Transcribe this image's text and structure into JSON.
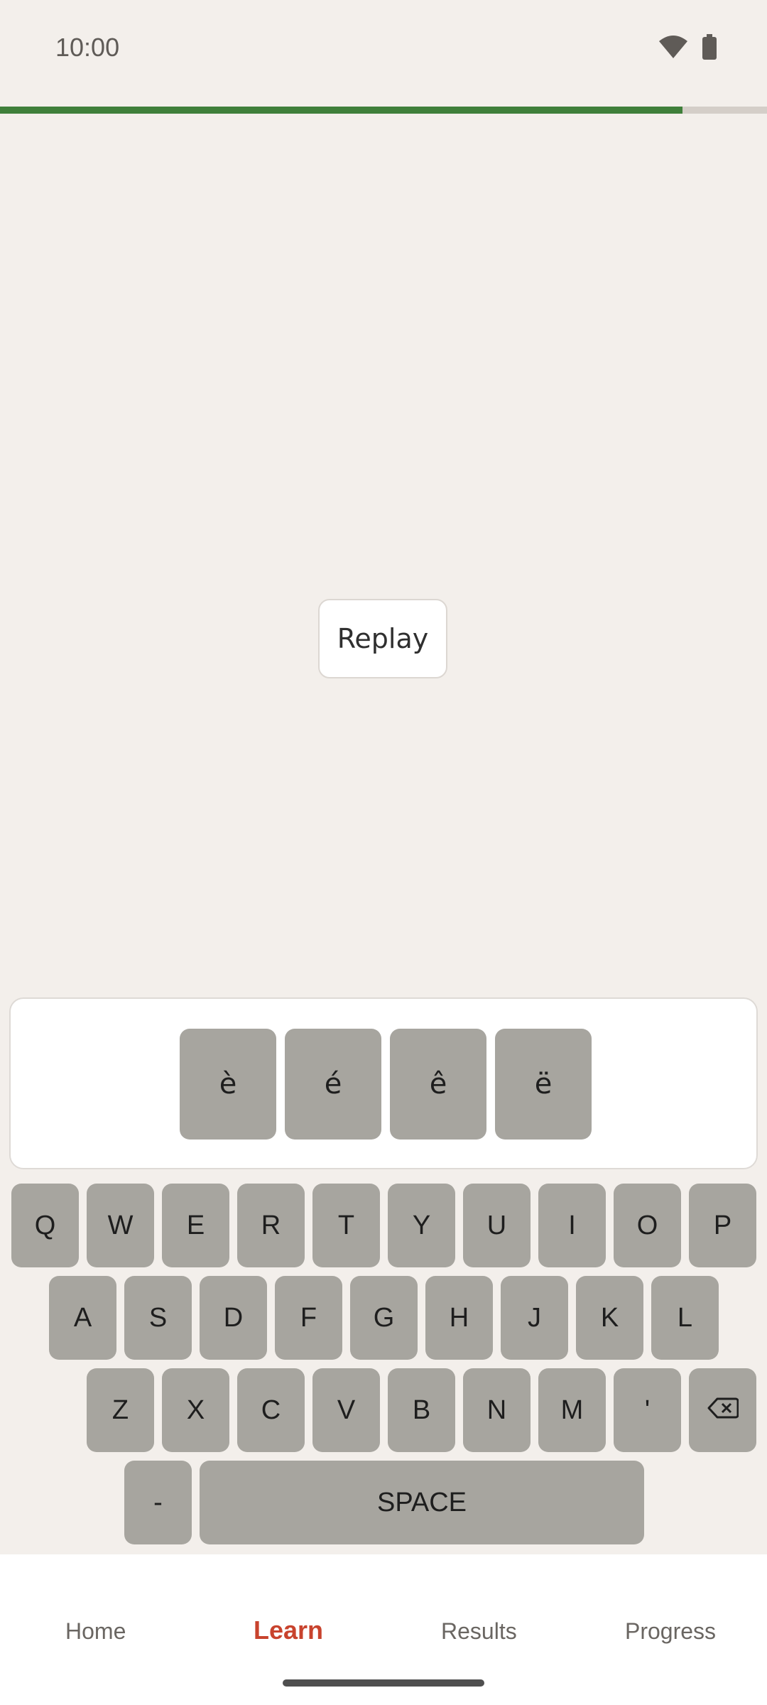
{
  "status_bar": {
    "time": "10:00",
    "icons": [
      "wifi-icon",
      "battery-icon"
    ]
  },
  "lesson": {
    "progress_fraction": 0.89
  },
  "main": {
    "replay_label": "Replay"
  },
  "accent_keys": [
    "è",
    "é",
    "ê",
    "ë"
  ],
  "keyboard": {
    "row1": [
      "Q",
      "W",
      "E",
      "R",
      "T",
      "Y",
      "U",
      "I",
      "O",
      "P"
    ],
    "row2": [
      "A",
      "S",
      "D",
      "F",
      "G",
      "H",
      "J",
      "K",
      "L"
    ],
    "row3": [
      "Z",
      "X",
      "C",
      "V",
      "B",
      "N",
      "M",
      "'"
    ],
    "backspace_icon": "backspace-icon",
    "dash": "-",
    "space": "SPACE"
  },
  "nav": {
    "home": "Home",
    "learn": "Learn",
    "results": "Results",
    "progress": "Progress",
    "active": "learn"
  },
  "colors": {
    "accent": "#c8432d",
    "progress": "#3f7f3a",
    "key": "#a7a59f",
    "background": "#f3efeb"
  }
}
